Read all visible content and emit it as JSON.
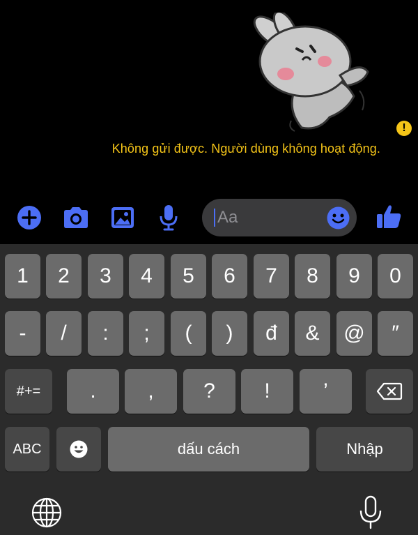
{
  "chat": {
    "error_message": "Không gửi được. Người dùng không hoạt động.",
    "warning_icon": "exclamation-icon",
    "sticker": "bunny-sticker"
  },
  "composer": {
    "input_placeholder": "Aa",
    "icons": [
      "plus-icon",
      "camera-icon",
      "image-icon",
      "microphone-icon",
      "emoji-icon",
      "thumbs-up-icon"
    ],
    "accent_color": "#4c6ef5"
  },
  "keyboard": {
    "row1": [
      "1",
      "2",
      "3",
      "4",
      "5",
      "6",
      "7",
      "8",
      "9",
      "0"
    ],
    "row2": [
      "-",
      "/",
      ":",
      ";",
      "(",
      ")",
      "đ",
      "&",
      "@",
      "″"
    ],
    "row3": [
      "#+=",
      ".",
      ",",
      "?",
      "!",
      "’"
    ],
    "abc_label": "ABC",
    "space_label": "dấu cách",
    "return_label": "Nhập",
    "icons": [
      "backspace-icon",
      "emoji-icon",
      "globe-icon",
      "dictation-mic-icon"
    ]
  },
  "colors": {
    "error_text": "#f5c518",
    "accent": "#4c6ef5",
    "key": "#6b6b6b",
    "key_dark": "#474747",
    "keyboard_bg": "#2b2b2b"
  }
}
